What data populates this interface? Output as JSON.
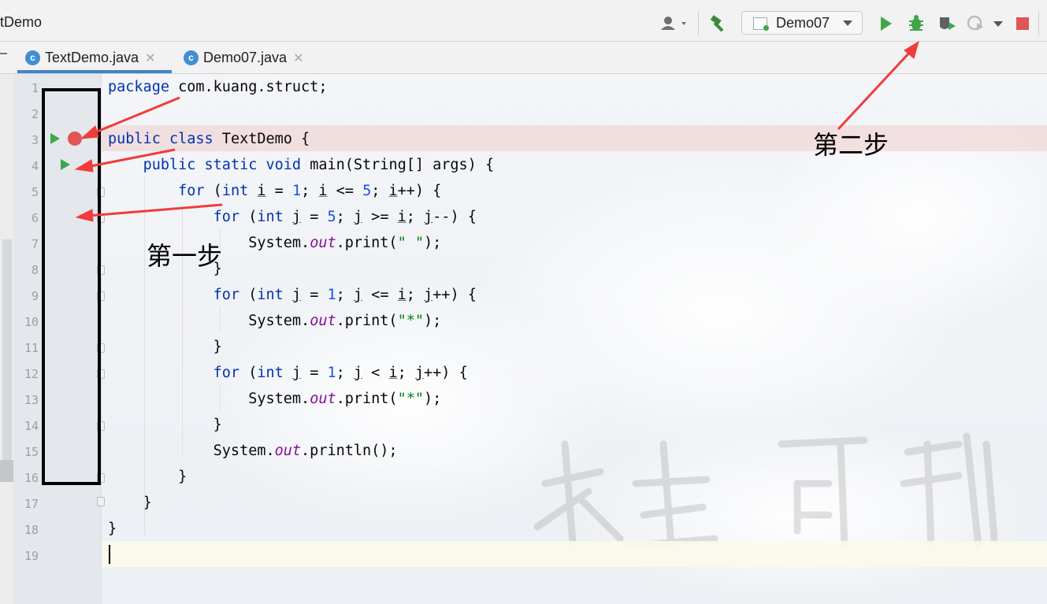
{
  "window": {
    "title": "tDemo"
  },
  "toolbar": {
    "run_config": "Demo07",
    "icons": [
      "user-icon",
      "hammer-build-icon",
      "run-icon",
      "debug-icon",
      "coverage-icon",
      "profile-icon",
      "stop-icon"
    ]
  },
  "tabs": [
    {
      "label": "TextDemo.java",
      "active": true,
      "close": "✕"
    },
    {
      "label": "Demo07.java",
      "active": false,
      "close": "✕"
    }
  ],
  "editor": {
    "line_numbers": [
      "1",
      "2",
      "3",
      "4",
      "5",
      "6",
      "7",
      "8",
      "9",
      "10",
      "11",
      "12",
      "13",
      "14",
      "15",
      "16",
      "17",
      "18",
      "19"
    ],
    "lines": [
      "package com.kuang.struct;",
      "",
      "public class TextDemo {",
      "    public static void main(String[] args) {",
      "        for (int i = 1; i <= 5; i++) {",
      "            for (int j = 5; j >= i; j--) {",
      "                System.out.print(\" \");",
      "            }",
      "            for (int j = 1; j <= i; j++) {",
      "                System.out.print(\"*\");",
      "            }",
      "            for (int j = 1; j < i; j++) {",
      "                System.out.print(\"*\");",
      "            }",
      "            System.out.println();",
      "        }",
      "    }",
      "}",
      ""
    ],
    "breakpoint_line": "3",
    "colors": {
      "keyword": "#0033b3",
      "number": "#1750eb",
      "string": "#067d17",
      "static_field": "#871094",
      "run_green": "#3fa64a",
      "breakpoint_red": "#e05555",
      "arrow_red": "#f23b3b"
    }
  },
  "annotations": {
    "step1": "第一步",
    "step2": "第二步",
    "watermark": "未来可期"
  }
}
